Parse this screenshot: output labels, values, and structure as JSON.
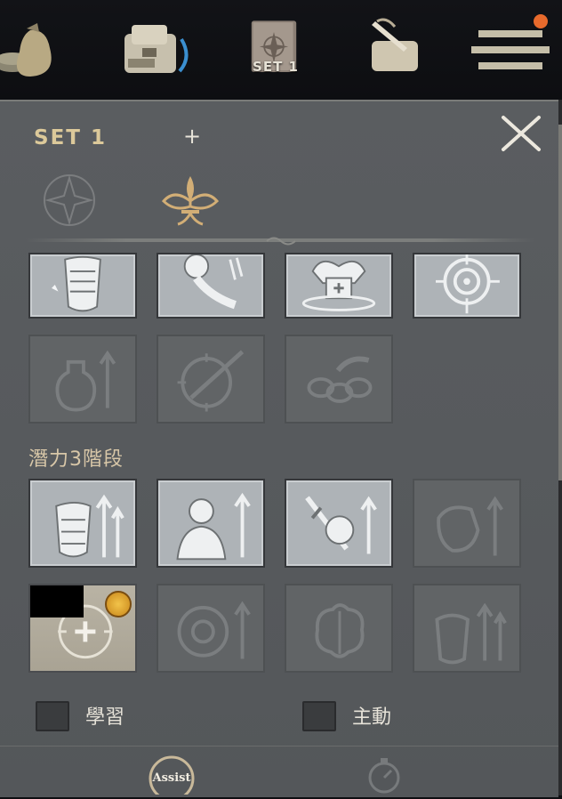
{
  "topbar": {
    "icons": [
      "money-bag-icon",
      "backpack-icon",
      "skill-book-icon",
      "quest-scroll-icon",
      "menu-icon"
    ],
    "active_set_label": "SET 1"
  },
  "panel": {
    "title": "SET 1",
    "add_label": "+",
    "tabs": [
      "compass-star-icon",
      "fleur-ornament-icon"
    ],
    "active_tab": 1,
    "row1": [
      "armor-skill-icon",
      "fist-power-icon",
      "body-heal-icon",
      "target-crosshair-icon"
    ],
    "row2": [
      "potion-up-icon",
      "compass-blade-icon",
      "chain-break-icon"
    ],
    "stage_label": "潛力3階段",
    "row3": [
      "armor-up-icon",
      "warrior-up-icon",
      "sword-apple-up-icon",
      "fist-up-icon"
    ],
    "row4": [
      "target-plus-icon",
      "target-up-icon",
      "brain-icon",
      "heart-armor-up-icon"
    ],
    "checkbox_learn": "學習",
    "checkbox_active": "主動",
    "assist_label": "Assist"
  },
  "colors": {
    "panel_bg": "#5a5d60",
    "title_gold": "#dcc99a",
    "medal": "#f2c34a"
  }
}
